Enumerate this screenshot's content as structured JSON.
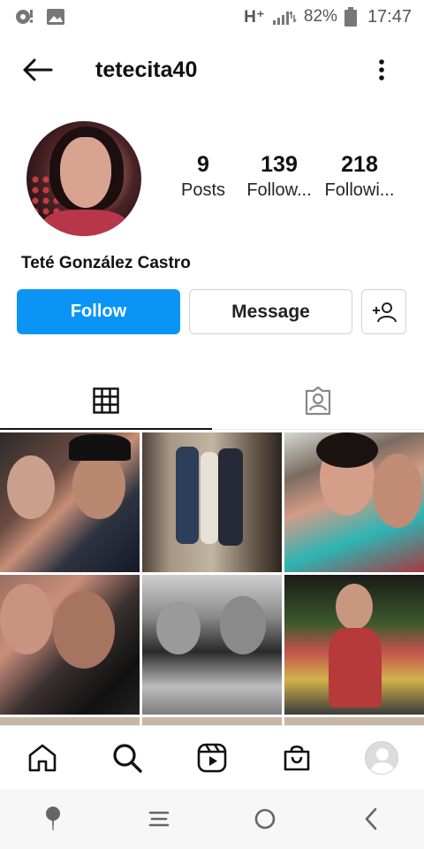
{
  "status_bar": {
    "network": "H⁺",
    "battery": "82%",
    "time": "17:47",
    "icons": [
      "notification-icon",
      "image-icon",
      "signal-icon",
      "battery-icon"
    ]
  },
  "header": {
    "username": "tetecita40",
    "icons": [
      "back-arrow-icon",
      "more-vertical-icon"
    ]
  },
  "profile": {
    "display_name": "Teté González Castro",
    "stats": [
      {
        "value": "9",
        "label": "Posts"
      },
      {
        "value": "139",
        "label": "Follow..."
      },
      {
        "value": "218",
        "label": "Followi..."
      }
    ]
  },
  "actions": {
    "follow_label": "Follow",
    "message_label": "Message",
    "suggest_icon": "add-person-icon"
  },
  "tabs": [
    {
      "name": "grid",
      "icon": "grid-icon",
      "active": true
    },
    {
      "name": "tagged",
      "icon": "tagged-person-icon",
      "active": false
    }
  ],
  "bottom_nav": [
    "home-icon",
    "search-icon",
    "reels-icon",
    "shop-icon",
    "profile-avatar"
  ],
  "system_nav": [
    "assistant-icon",
    "recents-icon",
    "home-circle-icon",
    "back-chevron-icon"
  ],
  "colors": {
    "follow_blue": "#0a95f6",
    "text_dark": "#262626"
  }
}
